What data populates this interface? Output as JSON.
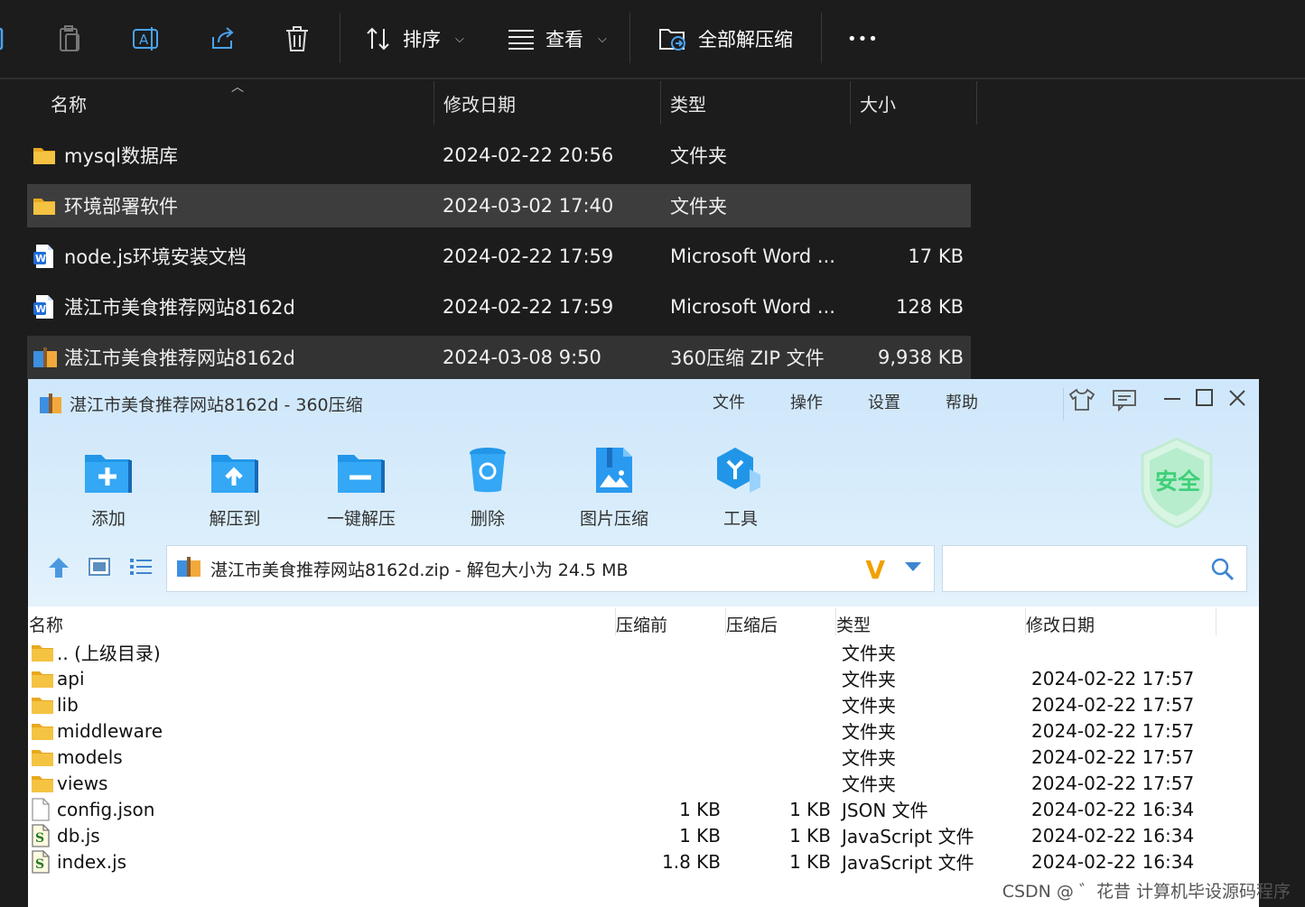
{
  "explorer": {
    "toolbar": {
      "sort_label": "排序",
      "view_label": "查看",
      "extract_all_label": "全部解压缩",
      "more_label": "•••"
    },
    "columns": {
      "name": "名称",
      "date": "修改日期",
      "type": "类型",
      "size": "大小"
    },
    "rows": [
      {
        "name": "mysql数据库",
        "date": "2024-02-22 20:56",
        "type": "文件夹",
        "size": "",
        "icon": "folder-icon"
      },
      {
        "name": "环境部署软件",
        "date": "2024-03-02 17:40",
        "type": "文件夹",
        "size": "",
        "icon": "folder-icon"
      },
      {
        "name": "node.js环境安装文档",
        "date": "2024-02-22 17:59",
        "type": "Microsoft Word ...",
        "size": "17 KB",
        "icon": "word-doc-icon"
      },
      {
        "name": "湛江市美食推荐网站8162d",
        "date": "2024-02-22 17:59",
        "type": "Microsoft Word ...",
        "size": "128 KB",
        "icon": "word-doc-icon"
      },
      {
        "name": "湛江市美食推荐网站8162d",
        "date": "2024-03-08 9:50",
        "type": "360压缩 ZIP 文件",
        "size": "9,938 KB",
        "icon": "zip-archive-icon"
      }
    ]
  },
  "zip": {
    "title": "湛江市美食推荐网站8162d - 360压缩",
    "menu": [
      "文件",
      "操作",
      "设置",
      "帮助"
    ],
    "tools": [
      "添加",
      "解压到",
      "一键解压",
      "删除",
      "图片压缩",
      "工具"
    ],
    "badge": "安全",
    "address": "湛江市美食推荐网站8162d.zip - 解包大小为 24.5 MB",
    "address_mark": "V",
    "search_placeholder": "",
    "columns": {
      "name": "名称",
      "before": "压缩前",
      "after": "压缩后",
      "type": "类型",
      "date": "修改日期"
    },
    "rows": [
      {
        "name": ".. (上级目录)",
        "before": "",
        "after": "",
        "type": "文件夹",
        "date": "",
        "icon": "folder-icon"
      },
      {
        "name": "api",
        "before": "",
        "after": "",
        "type": "文件夹",
        "date": "2024-02-22 17:57",
        "icon": "folder-icon"
      },
      {
        "name": "lib",
        "before": "",
        "after": "",
        "type": "文件夹",
        "date": "2024-02-22 17:57",
        "icon": "folder-icon"
      },
      {
        "name": "middleware",
        "before": "",
        "after": "",
        "type": "文件夹",
        "date": "2024-02-22 17:57",
        "icon": "folder-icon"
      },
      {
        "name": "models",
        "before": "",
        "after": "",
        "type": "文件夹",
        "date": "2024-02-22 17:57",
        "icon": "folder-icon"
      },
      {
        "name": "views",
        "before": "",
        "after": "",
        "type": "文件夹",
        "date": "2024-02-22 17:57",
        "icon": "folder-icon"
      },
      {
        "name": "config.json",
        "before": "1 KB",
        "after": "1 KB",
        "type": "JSON 文件",
        "date": "2024-02-22 16:34",
        "icon": "file-icon"
      },
      {
        "name": "db.js",
        "before": "1 KB",
        "after": "1 KB",
        "type": "JavaScript 文件",
        "date": "2024-02-22 16:34",
        "icon": "script-file-icon"
      },
      {
        "name": "index.js",
        "before": "1.8 KB",
        "after": "1 KB",
        "type": "JavaScript 文件",
        "date": "2024-02-22 16:34",
        "icon": "script-file-icon"
      }
    ]
  },
  "watermark": "CSDN @ ゛花昔  计算机毕设源码程序",
  "colors": {
    "explorer_bg": "#1c1c1c",
    "selection": "#3d3d3d",
    "zip_accent": "#1b8fe0",
    "folder": "#f5c342"
  }
}
